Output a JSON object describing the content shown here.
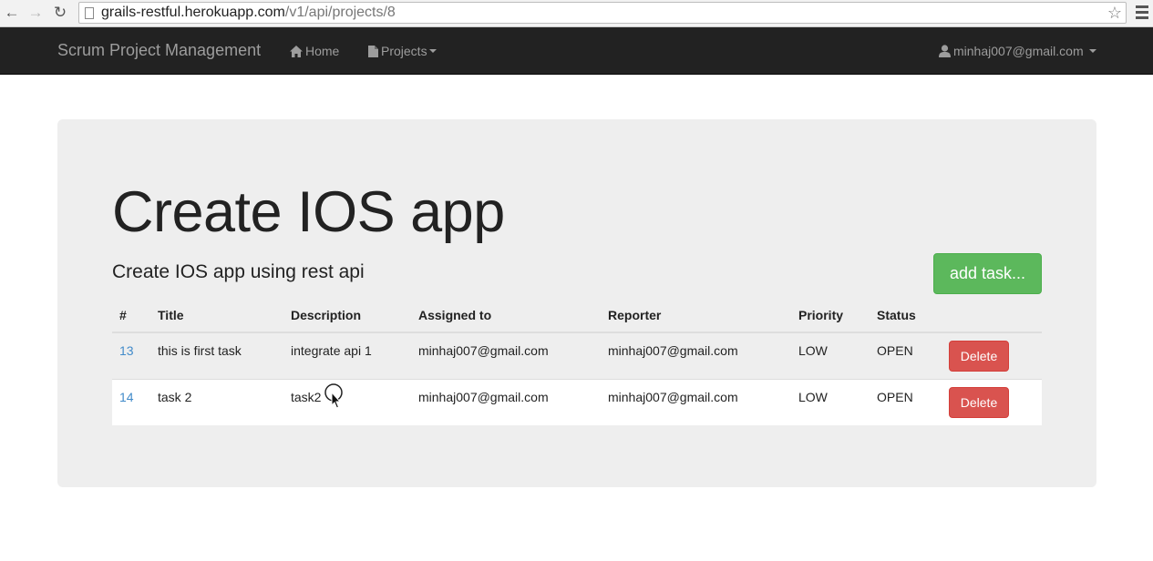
{
  "browser": {
    "url_host": "grails-restful.herokuapp.com",
    "url_path": "/v1/api/projects/8"
  },
  "navbar": {
    "brand": "Scrum Project Management",
    "home_label": "Home",
    "projects_label": "Projects",
    "user_label": "minhaj007@gmail.com"
  },
  "project": {
    "title": "Create IOS app",
    "description": "Create IOS app using rest api",
    "add_task_label": "add task..."
  },
  "table": {
    "headers": [
      "#",
      "Title",
      "Description",
      "Assigned to",
      "Reporter",
      "Priority",
      "Status"
    ],
    "rows": [
      {
        "id": "13",
        "title": "this is first task",
        "description": "integrate api 1",
        "assigned_to": "minhaj007@gmail.com",
        "reporter": "minhaj007@gmail.com",
        "priority": "LOW",
        "status": "OPEN",
        "delete_label": "Delete"
      },
      {
        "id": "14",
        "title": "task 2",
        "description": "task2",
        "assigned_to": "minhaj007@gmail.com",
        "reporter": "minhaj007@gmail.com",
        "priority": "LOW",
        "status": "OPEN",
        "delete_label": "Delete"
      }
    ]
  },
  "colors": {
    "navbar_bg": "#222222",
    "jumbotron_bg": "#eeeeee",
    "success": "#5cb85c",
    "danger": "#d9534f",
    "link": "#428bca"
  }
}
